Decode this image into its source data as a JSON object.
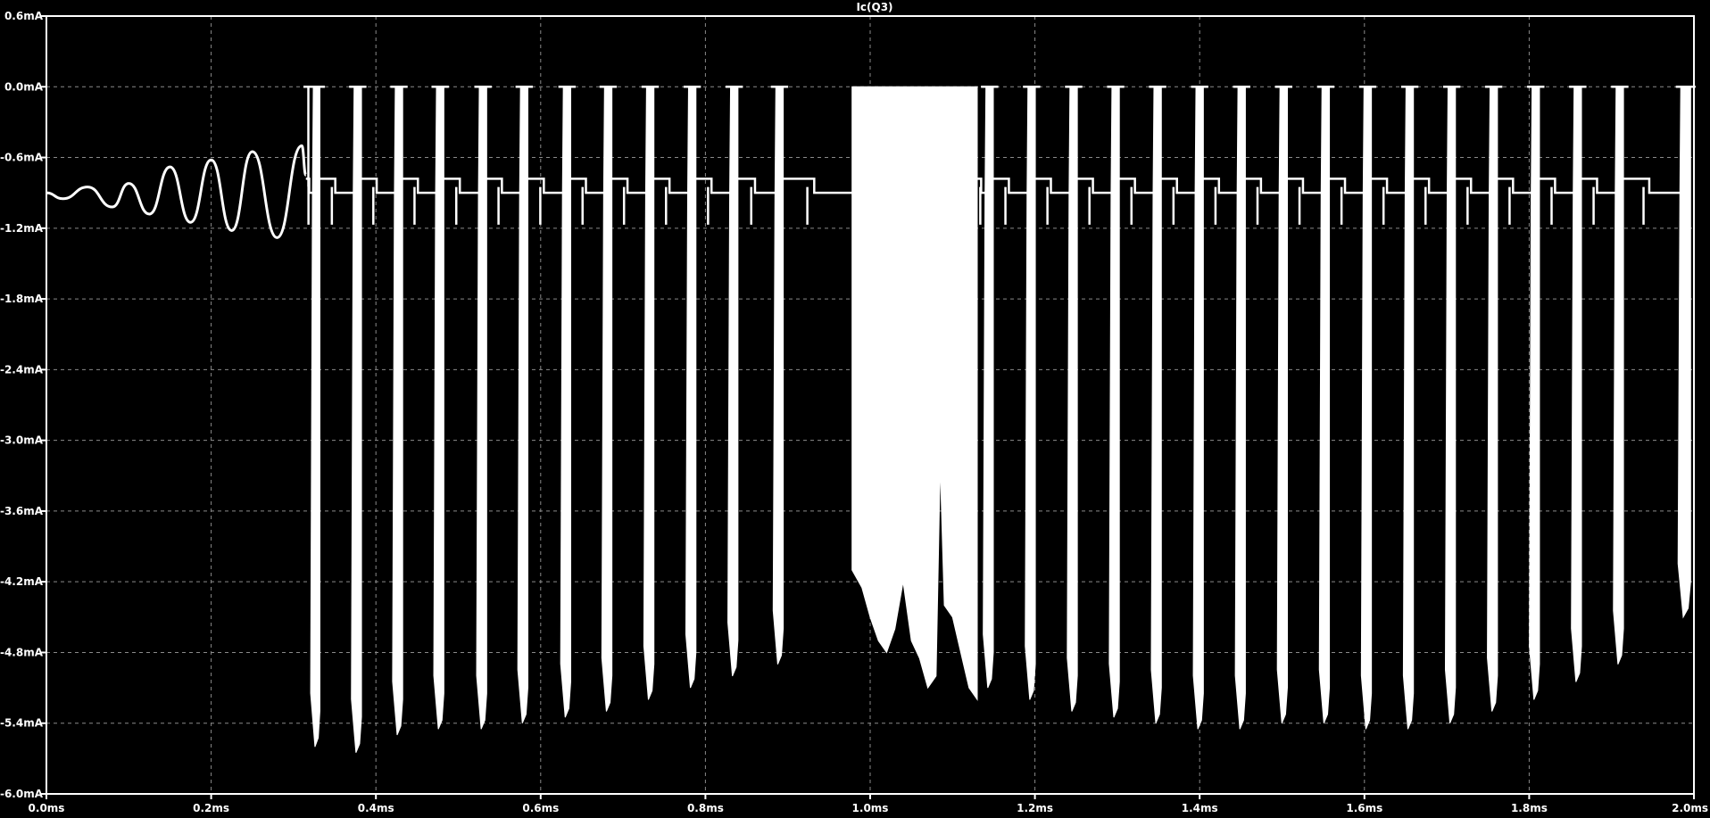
{
  "chart_data": {
    "type": "line",
    "title": "Ic(Q3)",
    "xlabel": "",
    "ylabel": "",
    "xlim": [
      0.0,
      2.0
    ],
    "ylim": [
      -6.0,
      0.6
    ],
    "x_unit": "ms",
    "y_unit": "mA",
    "grid": true,
    "x_ticks": [
      "0.0ms",
      "0.2ms",
      "0.4ms",
      "0.6ms",
      "0.8ms",
      "1.0ms",
      "1.2ms",
      "1.4ms",
      "1.6ms",
      "1.8ms",
      "2.0ms"
    ],
    "x_tick_values": [
      0.0,
      0.2,
      0.4,
      0.6,
      0.8,
      1.0,
      1.2,
      1.4,
      1.6,
      1.8,
      2.0
    ],
    "y_ticks": [
      "0.6mA",
      "0.0mA",
      "-0.6mA",
      "-1.2mA",
      "-1.8mA",
      "-2.4mA",
      "-3.0mA",
      "-3.6mA",
      "-4.2mA",
      "-4.8mA",
      "-5.4mA",
      "-6.0mA"
    ],
    "y_tick_values": [
      0.6,
      0.0,
      -0.6,
      -1.2,
      -1.8,
      -2.4,
      -3.0,
      -3.6,
      -4.2,
      -4.8,
      -5.4,
      -6.0
    ],
    "series": [
      {
        "color": "#ffffff",
        "startup_oscillation": {
          "x_start": 0.0,
          "x_end": 0.315,
          "center": -0.95,
          "points": [
            [
              0.0,
              -0.9
            ],
            [
              0.02,
              -0.95
            ],
            [
              0.05,
              -0.85
            ],
            [
              0.08,
              -1.02
            ],
            [
              0.1,
              -0.82
            ],
            [
              0.125,
              -1.08
            ],
            [
              0.15,
              -0.68
            ],
            [
              0.175,
              -1.15
            ],
            [
              0.2,
              -0.62
            ],
            [
              0.225,
              -1.22
            ],
            [
              0.25,
              -0.55
            ],
            [
              0.28,
              -1.28
            ],
            [
              0.31,
              -0.5
            ],
            [
              0.315,
              -0.75
            ]
          ]
        },
        "plateau_level": -0.85,
        "top_level": 0.0,
        "pulses": [
          {
            "x": 0.328,
            "w": 0.008,
            "min": -5.6
          },
          {
            "x": 0.378,
            "w": 0.009,
            "min": -5.65
          },
          {
            "x": 0.428,
            "w": 0.009,
            "min": -5.5
          },
          {
            "x": 0.478,
            "w": 0.009,
            "min": -5.45
          },
          {
            "x": 0.53,
            "w": 0.009,
            "min": -5.45
          },
          {
            "x": 0.58,
            "w": 0.009,
            "min": -5.4
          },
          {
            "x": 0.632,
            "w": 0.009,
            "min": -5.35
          },
          {
            "x": 0.682,
            "w": 0.009,
            "min": -5.3
          },
          {
            "x": 0.733,
            "w": 0.009,
            "min": -5.2
          },
          {
            "x": 0.784,
            "w": 0.009,
            "min": -5.1
          },
          {
            "x": 0.835,
            "w": 0.009,
            "min": -5.0
          },
          {
            "x": 0.89,
            "w": 0.009,
            "min": -4.9
          },
          {
            "x": 1.145,
            "w": 0.009,
            "min": -5.1
          },
          {
            "x": 1.196,
            "w": 0.009,
            "min": -5.2
          },
          {
            "x": 1.247,
            "w": 0.009,
            "min": -5.3
          },
          {
            "x": 1.298,
            "w": 0.009,
            "min": -5.35
          },
          {
            "x": 1.349,
            "w": 0.009,
            "min": -5.4
          },
          {
            "x": 1.4,
            "w": 0.009,
            "min": -5.45
          },
          {
            "x": 1.451,
            "w": 0.009,
            "min": -5.45
          },
          {
            "x": 1.502,
            "w": 0.009,
            "min": -5.4
          },
          {
            "x": 1.553,
            "w": 0.009,
            "min": -5.4
          },
          {
            "x": 1.604,
            "w": 0.009,
            "min": -5.45
          },
          {
            "x": 1.655,
            "w": 0.009,
            "min": -5.45
          },
          {
            "x": 1.706,
            "w": 0.009,
            "min": -5.4
          },
          {
            "x": 1.757,
            "w": 0.009,
            "min": -5.3
          },
          {
            "x": 1.808,
            "w": 0.009,
            "min": -5.2
          },
          {
            "x": 1.859,
            "w": 0.009,
            "min": -5.05
          },
          {
            "x": 1.91,
            "w": 0.009,
            "min": -4.9
          },
          {
            "x": 1.99,
            "w": 0.012,
            "min": -4.5
          }
        ],
        "dense_block": {
          "x_start": 0.978,
          "x_end": 1.13,
          "top": 0.0,
          "bottom_envelope": [
            [
              0.978,
              -4.1
            ],
            [
              0.99,
              -4.25
            ],
            [
              1.0,
              -4.5
            ],
            [
              1.01,
              -4.7
            ],
            [
              1.02,
              -4.8
            ],
            [
              1.03,
              -4.6
            ],
            [
              1.04,
              -4.2
            ],
            [
              1.05,
              -4.7
            ],
            [
              1.06,
              -4.85
            ],
            [
              1.07,
              -5.1
            ],
            [
              1.08,
              -5.0
            ],
            [
              1.085,
              -3.2
            ],
            [
              1.09,
              -4.4
            ],
            [
              1.1,
              -4.5
            ],
            [
              1.11,
              -4.8
            ],
            [
              1.12,
              -5.1
            ],
            [
              1.13,
              -5.2
            ]
          ]
        }
      }
    ]
  }
}
